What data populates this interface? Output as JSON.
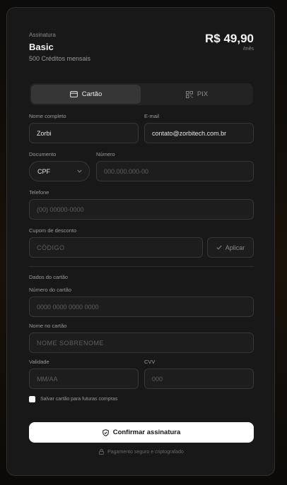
{
  "plan": {
    "kicker": "Assinatura",
    "name": "Basic",
    "description": "500 Créditos mensais",
    "price": "R$ 49,90",
    "period": "/mês"
  },
  "tabs": {
    "card": {
      "label": "Cartão",
      "icon": "credit-card-icon",
      "active": true
    },
    "pix": {
      "label": "PIX",
      "icon": "qr-code-icon",
      "active": false
    }
  },
  "form": {
    "full_name": {
      "label": "Nome completo",
      "value": "Zorbi"
    },
    "email": {
      "label": "E-mail",
      "value": "contato@zorbitech.com.br"
    },
    "document": {
      "label": "Documento",
      "selected": "CPF"
    },
    "number": {
      "label": "Número",
      "placeholder": "000.000.000-00"
    },
    "phone": {
      "label": "Telefone",
      "placeholder": "(00) 00000-0000"
    },
    "coupon": {
      "label": "Cupom de desconto",
      "placeholder": "CÓDIGO",
      "apply_label": "Aplicar"
    }
  },
  "card_section": {
    "title": "Dados do cartão",
    "card_number": {
      "label": "Número do cartão",
      "placeholder": "0000 0000 0000 0000"
    },
    "card_name": {
      "label": "Nome no cartão",
      "placeholder": "NOME SOBRENOME"
    },
    "expiry": {
      "label": "Validade",
      "placeholder": "MM/AA"
    },
    "cvv": {
      "label": "CVV",
      "placeholder": "000"
    },
    "save_card_label": "Salvar cartão para futuras compras"
  },
  "actions": {
    "confirm_label": "Confirmar assinatura",
    "secure_note": "Pagamento seguro e criptografado"
  },
  "colors": {
    "card_background": "#181818",
    "input_background": "#1d1d1d",
    "border": "#363636",
    "primary_button": "#ffffff"
  }
}
